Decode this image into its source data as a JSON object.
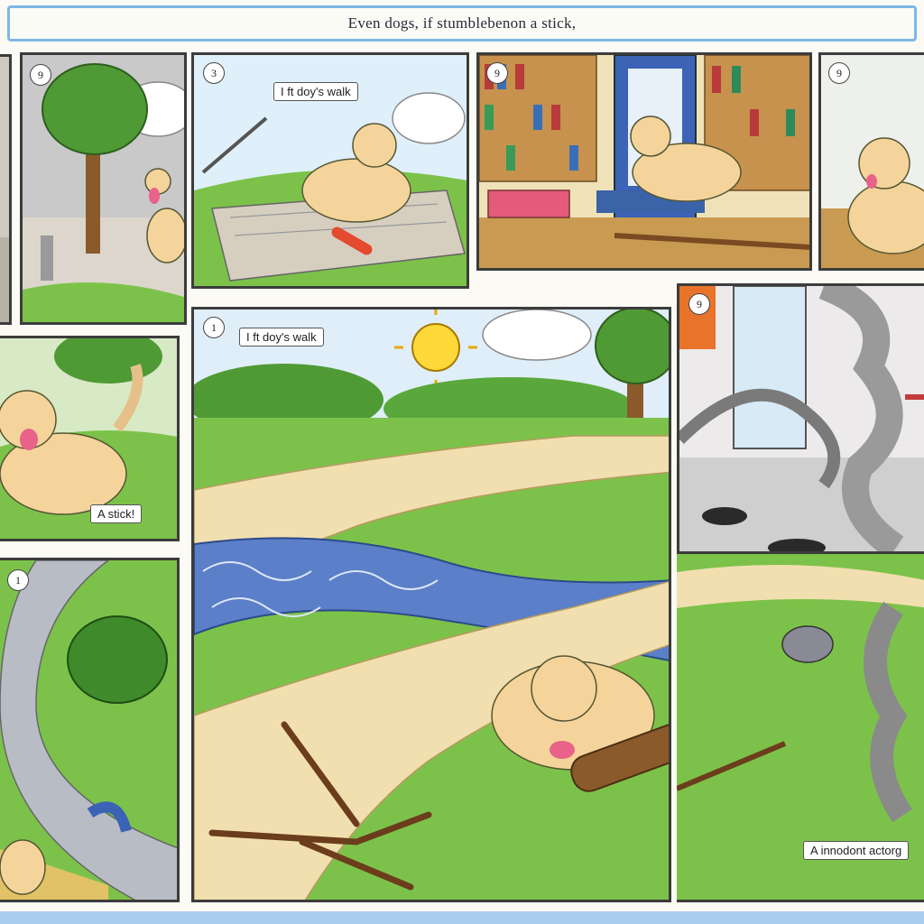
{
  "title": "Even dogs, if stumblebenon a stick,",
  "panels": {
    "panel_2": {
      "number": "9"
    },
    "panel_3": {
      "number": "3",
      "caption": "I ft doy's walk"
    },
    "panel_4": {
      "number": "9"
    },
    "panel_5": {
      "number": "9"
    },
    "panel_6": {
      "caption": "A stick!"
    },
    "panel_7": {
      "number": "1",
      "caption": "I ft doy's walk"
    },
    "panel_8": {
      "number": "9"
    },
    "panel_9": {
      "number": "1"
    },
    "panel_10": {
      "caption": "A innodont actorg"
    }
  },
  "colors": {
    "frame_blue": "#7fb6e8",
    "grass": "#7cc24a",
    "path": "#f1dfb0",
    "dog": "#f4d49a",
    "water": "#5b7fc8",
    "sky": "#dfeef8"
  }
}
